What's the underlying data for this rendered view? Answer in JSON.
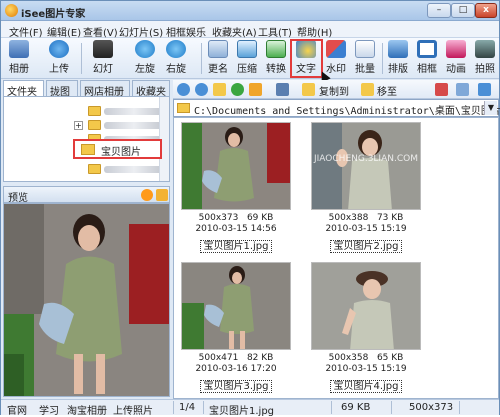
{
  "window": {
    "title": "iSee图片专家",
    "btn_min": "–",
    "btn_max": "□",
    "btn_close": "x"
  },
  "menu": [
    "文件(F)",
    "编辑(E)",
    "查看(V)",
    "幻灯片(S)",
    "相框娱乐",
    "收藏夹(A)",
    "工具(T)",
    "帮助(H)"
  ],
  "toolbar": [
    "相册",
    "上传",
    "幻灯",
    "左旋",
    "右旋",
    "更名",
    "压缩",
    "转换",
    "文字",
    "水印",
    "批量",
    "排版",
    "相框",
    "动画",
    "拍照"
  ],
  "left_tabs": [
    "文件夹",
    "拢图",
    "网店相册",
    "收藏夹"
  ],
  "tree": {
    "expander": "+",
    "selected_folder": "宝贝图片"
  },
  "preview": {
    "title": "预览"
  },
  "path_tools": {
    "copy_to": "复制到",
    "move_to": "移至"
  },
  "path": {
    "value": "C:\\Documents and Settings\\Administrator\\桌面\\宝贝图片"
  },
  "thumbnails": [
    {
      "dims": "500x373",
      "size": "69 KB",
      "date": "2010-03-15 14:56",
      "name": "宝贝图片1.jpg"
    },
    {
      "dims": "500x388",
      "size": "73 KB",
      "date": "2010-03-15 15:19",
      "name": "宝贝图片2.jpg"
    },
    {
      "dims": "500x471",
      "size": "82 KB",
      "date": "2010-03-16 17:20",
      "name": "宝贝图片3.jpg"
    },
    {
      "dims": "500x358",
      "size": "65 KB",
      "date": "2010-03-15 15:19",
      "name": "宝贝图片4.jpg"
    }
  ],
  "watermark": "JIAOCHENG.3LIAN.COM",
  "status": {
    "links": [
      "官网",
      "学习",
      "淘宝相册",
      "上传照片"
    ],
    "page": "1/4",
    "file": "宝贝图片1.jpg",
    "size": "69 KB",
    "dims": "500x373"
  }
}
